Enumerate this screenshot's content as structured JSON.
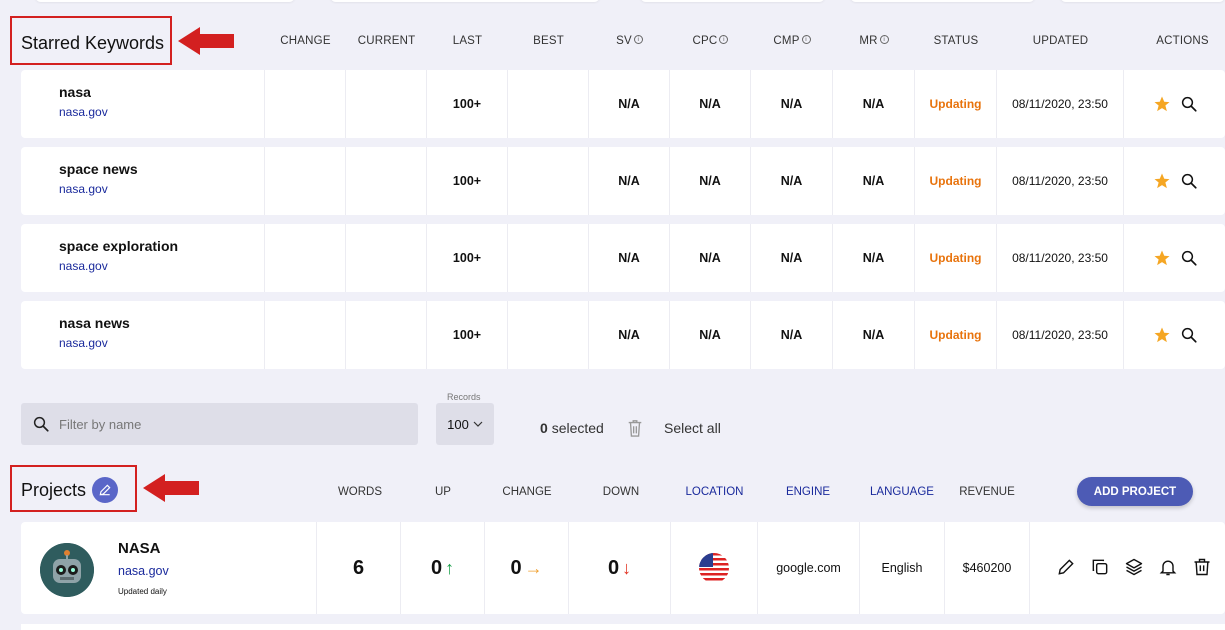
{
  "starred": {
    "title": "Starred Keywords",
    "columns": {
      "change": "CHANGE",
      "current": "CURRENT",
      "last": "LAST",
      "best": "BEST",
      "sv": "SV",
      "cpc": "CPC",
      "cmp": "CMP",
      "mr": "MR",
      "status": "STATUS",
      "updated": "UPDATED",
      "actions": "ACTIONS"
    },
    "rows": [
      {
        "keyword": "nasa",
        "domain": "nasa.gov",
        "change": "",
        "current": "",
        "last": "100+",
        "best": "",
        "sv": "N/A",
        "cpc": "N/A",
        "cmp": "N/A",
        "mr": "N/A",
        "status": "Updating",
        "updated": "08/11/2020, 23:50"
      },
      {
        "keyword": "space news",
        "domain": "nasa.gov",
        "change": "",
        "current": "",
        "last": "100+",
        "best": "",
        "sv": "N/A",
        "cpc": "N/A",
        "cmp": "N/A",
        "mr": "N/A",
        "status": "Updating",
        "updated": "08/11/2020, 23:50"
      },
      {
        "keyword": "space exploration",
        "domain": "nasa.gov",
        "change": "",
        "current": "",
        "last": "100+",
        "best": "",
        "sv": "N/A",
        "cpc": "N/A",
        "cmp": "N/A",
        "mr": "N/A",
        "status": "Updating",
        "updated": "08/11/2020, 23:50"
      },
      {
        "keyword": "nasa news",
        "domain": "nasa.gov",
        "change": "",
        "current": "",
        "last": "100+",
        "best": "",
        "sv": "N/A",
        "cpc": "N/A",
        "cmp": "N/A",
        "mr": "N/A",
        "status": "Updating",
        "updated": "08/11/2020, 23:50"
      }
    ]
  },
  "filter": {
    "placeholder": "Filter by name",
    "records_label": "Records",
    "records_value": "100",
    "selected_count": "0",
    "selected_label": "selected",
    "select_all": "Select all"
  },
  "projects": {
    "title": "Projects",
    "columns": {
      "words": "WORDS",
      "up": "UP",
      "change": "CHANGE",
      "down": "DOWN",
      "location": "LOCATION",
      "engine": "ENGINE",
      "language": "LANGUAGE",
      "revenue": "REVENUE"
    },
    "add_label": "ADD PROJECT",
    "rows": [
      {
        "name": "NASA",
        "domain": "nasa.gov",
        "frequency": "Updated daily",
        "words": "6",
        "up": "0",
        "change": "0",
        "down": "0",
        "location_icon": "us-flag-icon",
        "engine": "google.com",
        "language": "English",
        "revenue": "$460200"
      }
    ]
  },
  "colors": {
    "accent": "#4d5bb5",
    "status_updating": "#e8730c",
    "link": "#1a2a9c",
    "annotation": "#d32020",
    "star": "#f5a623"
  }
}
